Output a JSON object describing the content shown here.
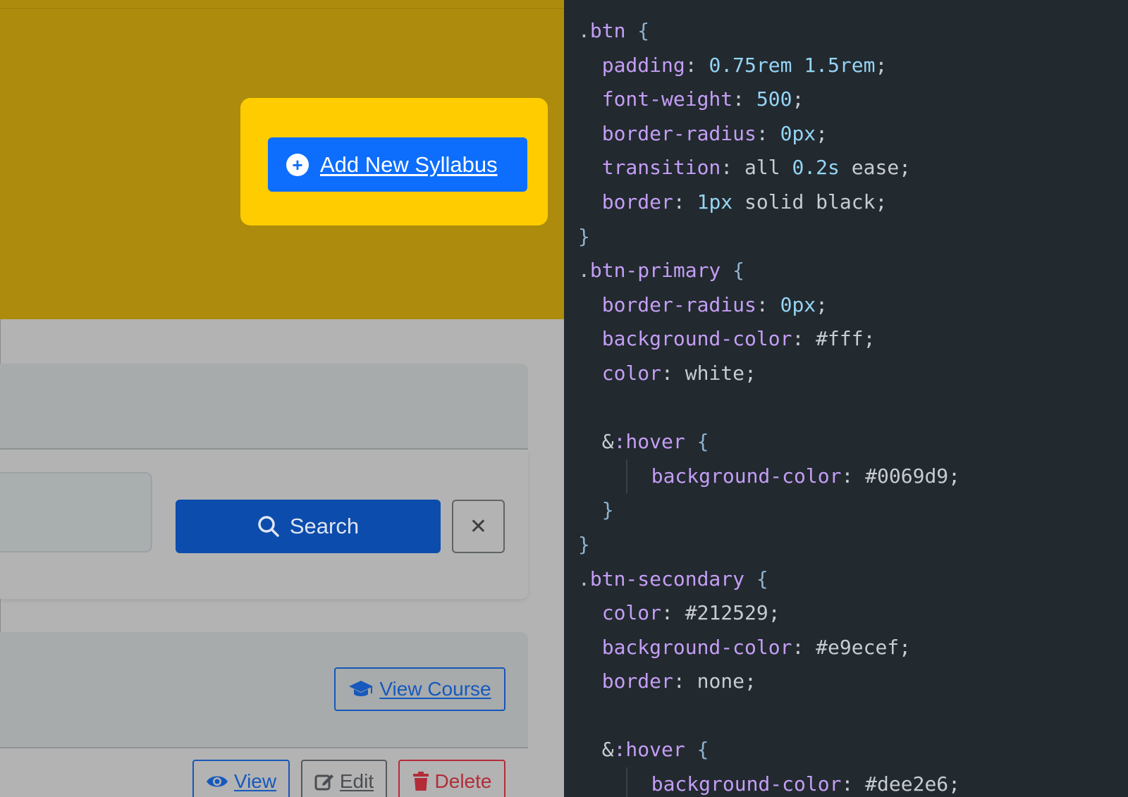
{
  "left_pane": {
    "add_button_label": "Add New Syllabus",
    "add_button_icon": "plus-circle-icon",
    "search": {
      "input_value": "",
      "button_label": "Search",
      "button_icon": "search-icon",
      "clear_icon": "close-icon",
      "clear_glyph": "✕"
    },
    "course_actions": {
      "view_course_label": "View Course",
      "view_course_icon": "graduation-cap-icon"
    },
    "row_actions": {
      "view_label": "View",
      "view_icon": "eye-icon",
      "edit_label": "Edit",
      "edit_icon": "edit-icon",
      "delete_label": "Delete",
      "delete_icon": "trash-icon"
    },
    "colors": {
      "header_band": "#ad8b0c",
      "highlight": "#ffcc00",
      "primary_button": "#0d6efd",
      "search_button": "#0c4cad",
      "delete": "#b32c38"
    }
  },
  "code_editor": {
    "background": "#22292f",
    "lines": [
      [
        {
          "t": ".btn",
          "c": "sel"
        },
        {
          "t": " {",
          "c": "brace"
        }
      ],
      [
        {
          "t": "  "
        },
        {
          "t": "padding",
          "c": "prop"
        },
        {
          "t": ": ",
          "c": "punct"
        },
        {
          "t": "0.75rem 1.5rem",
          "c": "num"
        },
        {
          "t": ";",
          "c": "punct"
        }
      ],
      [
        {
          "t": "  "
        },
        {
          "t": "font-weight",
          "c": "prop"
        },
        {
          "t": ": ",
          "c": "punct"
        },
        {
          "t": "500",
          "c": "num"
        },
        {
          "t": ";",
          "c": "punct"
        }
      ],
      [
        {
          "t": "  "
        },
        {
          "t": "border-radius",
          "c": "prop"
        },
        {
          "t": ": ",
          "c": "punct"
        },
        {
          "t": "0px",
          "c": "num"
        },
        {
          "t": ";",
          "c": "punct"
        }
      ],
      [
        {
          "t": "  "
        },
        {
          "t": "transition",
          "c": "prop"
        },
        {
          "t": ": ",
          "c": "punct"
        },
        {
          "t": "all ",
          "c": "val"
        },
        {
          "t": "0.2s",
          "c": "num"
        },
        {
          "t": " ease;",
          "c": "val"
        }
      ],
      [
        {
          "t": "  "
        },
        {
          "t": "border",
          "c": "prop"
        },
        {
          "t": ": ",
          "c": "punct"
        },
        {
          "t": "1px",
          "c": "num"
        },
        {
          "t": " solid black;",
          "c": "val"
        }
      ],
      [
        {
          "t": "}",
          "c": "brace"
        }
      ],
      [
        {
          "t": ".btn-primary",
          "c": "sel"
        },
        {
          "t": " {",
          "c": "brace"
        }
      ],
      [
        {
          "t": "  "
        },
        {
          "t": "border-radius",
          "c": "prop"
        },
        {
          "t": ": ",
          "c": "punct"
        },
        {
          "t": "0px",
          "c": "num"
        },
        {
          "t": ";",
          "c": "punct"
        }
      ],
      [
        {
          "t": "  "
        },
        {
          "t": "background-color",
          "c": "prop"
        },
        {
          "t": ": ",
          "c": "punct"
        },
        {
          "t": "#fff;",
          "c": "val"
        }
      ],
      [
        {
          "t": "  "
        },
        {
          "t": "color",
          "c": "prop"
        },
        {
          "t": ": ",
          "c": "punct"
        },
        {
          "t": "white;",
          "c": "val"
        }
      ],
      [
        {
          "t": ""
        }
      ],
      [
        {
          "t": "  "
        },
        {
          "t": "&",
          "c": "amp"
        },
        {
          "t": ":hover",
          "c": "pseudo"
        },
        {
          "t": " {",
          "c": "brace"
        }
      ],
      [
        {
          "t": "  "
        },
        {
          "t": "guide",
          "c": "guide"
        },
        {
          "t": "background-color",
          "c": "prop"
        },
        {
          "t": ": ",
          "c": "punct"
        },
        {
          "t": "#0069d9;",
          "c": "val"
        }
      ],
      [
        {
          "t": "  "
        },
        {
          "t": "}",
          "c": "brace"
        }
      ],
      [
        {
          "t": "}",
          "c": "brace"
        }
      ],
      [
        {
          "t": ".btn-secondary",
          "c": "sel"
        },
        {
          "t": " {",
          "c": "brace"
        }
      ],
      [
        {
          "t": "  "
        },
        {
          "t": "color",
          "c": "prop"
        },
        {
          "t": ": ",
          "c": "punct"
        },
        {
          "t": "#212529;",
          "c": "val"
        }
      ],
      [
        {
          "t": "  "
        },
        {
          "t": "background-color",
          "c": "prop"
        },
        {
          "t": ": ",
          "c": "punct"
        },
        {
          "t": "#e9ecef;",
          "c": "val"
        }
      ],
      [
        {
          "t": "  "
        },
        {
          "t": "border",
          "c": "prop"
        },
        {
          "t": ": ",
          "c": "punct"
        },
        {
          "t": "none;",
          "c": "val"
        }
      ],
      [
        {
          "t": ""
        }
      ],
      [
        {
          "t": "  "
        },
        {
          "t": "&",
          "c": "amp"
        },
        {
          "t": ":hover",
          "c": "pseudo"
        },
        {
          "t": " {",
          "c": "brace"
        }
      ],
      [
        {
          "t": "  "
        },
        {
          "t": "guide",
          "c": "guide"
        },
        {
          "t": "background-color",
          "c": "prop"
        },
        {
          "t": ": ",
          "c": "punct"
        },
        {
          "t": "#dee2e6;",
          "c": "val"
        }
      ]
    ]
  }
}
